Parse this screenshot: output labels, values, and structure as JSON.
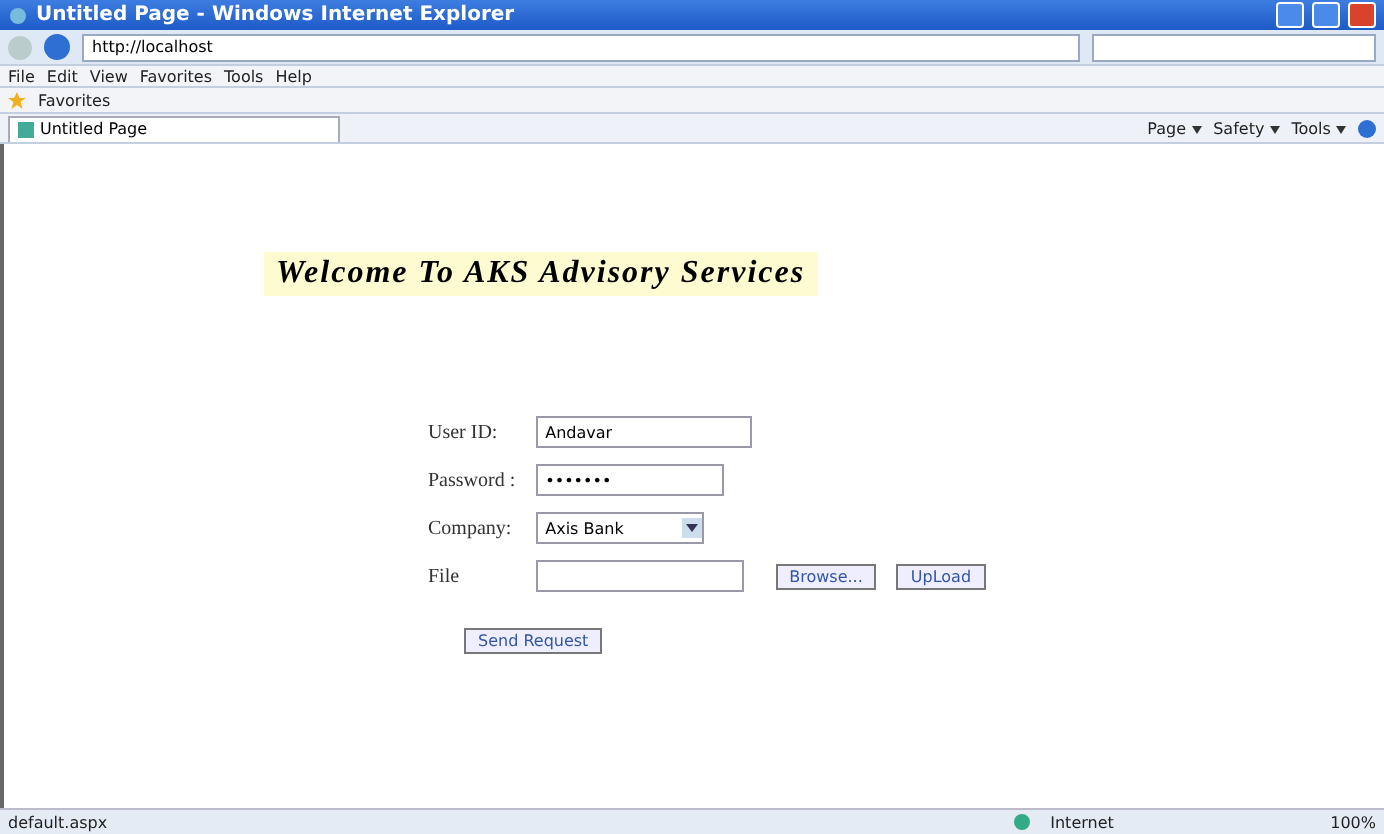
{
  "window": {
    "title": "Untitled Page - Windows Internet Explorer"
  },
  "address_bar": {
    "value": "http://localhost"
  },
  "menu": [
    "File",
    "Edit",
    "View",
    "Favorites",
    "Tools",
    "Help"
  ],
  "favorites_bar": {
    "label": "Favorites"
  },
  "tab": {
    "label": "Untitled Page"
  },
  "command_bar": [
    "Page",
    "Safety",
    "Tools"
  ],
  "page": {
    "heading": "Welcome To AKS Advisory Services",
    "fields": [
      {
        "kind": "text",
        "label": "User ID:",
        "value": "Andavar"
      },
      {
        "kind": "password",
        "label": "Password :",
        "value": "•••••••"
      },
      {
        "kind": "select",
        "label": "Company:",
        "value": "Axis Bank"
      },
      {
        "kind": "file",
        "label": "File",
        "button": "Browse...",
        "action": "UpLoad"
      }
    ],
    "submit": "Send Request"
  },
  "status_bar": {
    "text": "default.aspx",
    "zone": "Internet",
    "zoom": "100%"
  }
}
